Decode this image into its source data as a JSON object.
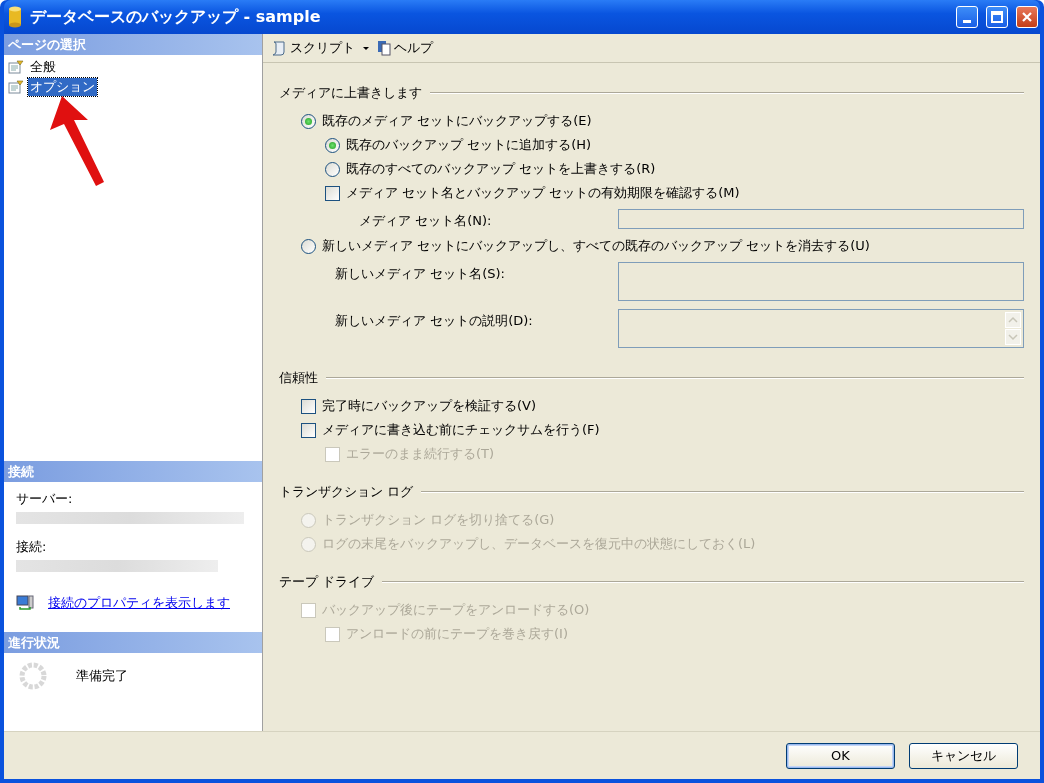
{
  "window": {
    "title": "データベースのバックアップ - sample"
  },
  "sidebar": {
    "page_select": {
      "heading": "ページの選択",
      "items": [
        {
          "label": "全般",
          "selected": false
        },
        {
          "label": "オプション",
          "selected": true
        }
      ]
    },
    "connection": {
      "heading": "接続",
      "server_label": "サーバー:",
      "connection_label": "接続:",
      "link": "接続のプロパティを表示します"
    },
    "progress": {
      "heading": "進行状況",
      "status": "準備完了"
    }
  },
  "toolbar": [
    {
      "kind": "script",
      "label": "スクリプト"
    },
    {
      "kind": "help",
      "label": "ヘルプ"
    }
  ],
  "content": {
    "sections": [
      {
        "title": "メディアに上書きします",
        "items": [
          {
            "kind": "radio",
            "label": "既存のメディア セットにバックアップする(E)",
            "selected": true,
            "disabled": false,
            "children": [
              {
                "kind": "radio",
                "label": "既存のバックアップ セットに追加する(H)",
                "selected": true,
                "disabled": false
              },
              {
                "kind": "radio",
                "label": "既存のすべてのバックアップ セットを上書きする(R)",
                "selected": false,
                "disabled": false
              },
              {
                "kind": "checkbox",
                "label": "メディア セット名とバックアップ セットの有効期限を確認する(M)",
                "checked": false,
                "disabled": false,
                "children": [
                  {
                    "kind": "text_field",
                    "label": "メディア セット名(N):"
                  }
                ]
              }
            ]
          },
          {
            "kind": "radio",
            "label": "新しいメディア セットにバックアップし、すべての既存のバックアップ セットを消去する(U)",
            "selected": false,
            "disabled": false,
            "children": [
              {
                "kind": "tall_field",
                "label": "新しいメディア セット名(S):"
              },
              {
                "kind": "memo_field",
                "label": "新しいメディア セットの説明(D):"
              }
            ]
          }
        ]
      },
      {
        "title": "信頼性",
        "items": [
          {
            "kind": "checkbox",
            "label": "完了時にバックアップを検証する(V)",
            "checked": false,
            "disabled": false
          },
          {
            "kind": "checkbox",
            "label": "メディアに書き込む前にチェックサムを行う(F)",
            "checked": false,
            "disabled": false,
            "children": [
              {
                "kind": "checkbox",
                "label": "エラーのまま続行する(T)",
                "checked": false,
                "disabled": true
              }
            ]
          }
        ]
      },
      {
        "title": "トランザクション ログ",
        "items": [
          {
            "kind": "radio",
            "label": "トランザクション ログを切り捨てる(G)",
            "selected": false,
            "disabled": true
          },
          {
            "kind": "radio",
            "label": "ログの末尾をバックアップし、データベースを復元中の状態にしておく(L)",
            "selected": false,
            "disabled": true
          }
        ]
      },
      {
        "title": "テープ ドライブ",
        "items": [
          {
            "kind": "checkbox",
            "label": "バックアップ後にテープをアンロードする(O)",
            "checked": false,
            "disabled": true,
            "children": [
              {
                "kind": "checkbox",
                "label": "アンロードの前にテープを巻き戻す(I)",
                "checked": false,
                "disabled": true
              }
            ]
          }
        ]
      }
    ]
  },
  "buttons": [
    {
      "label": "OK",
      "default": true
    },
    {
      "label": "キャンセル",
      "default": false
    }
  ]
}
